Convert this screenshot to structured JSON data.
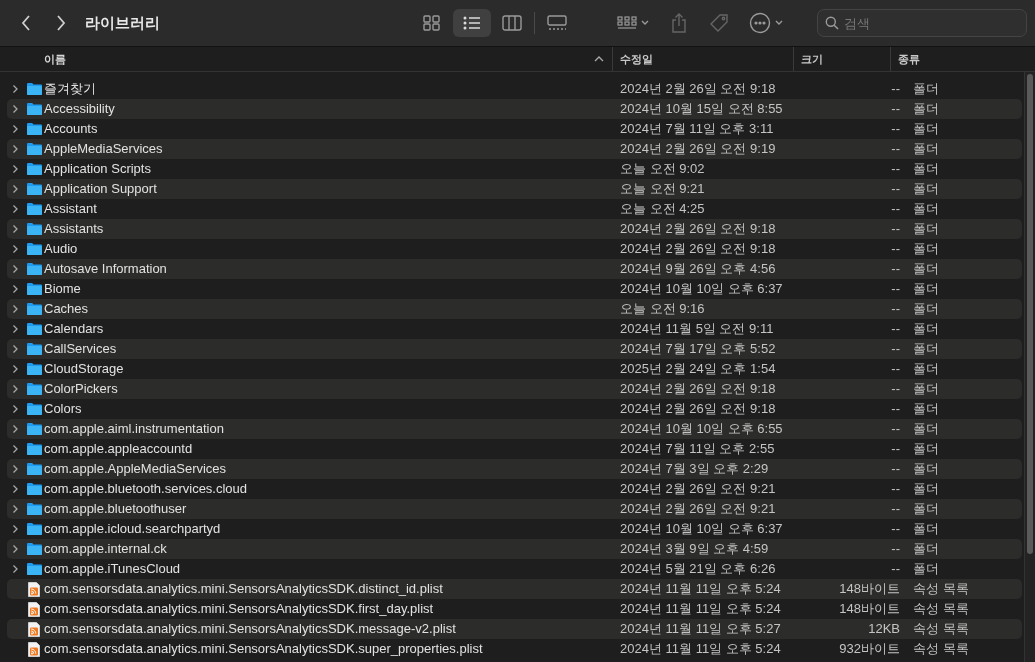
{
  "toolbar": {
    "title": "라이브러리",
    "views": [
      {
        "kind": "icons",
        "selected": false
      },
      {
        "kind": "list",
        "selected": true
      },
      {
        "kind": "columns",
        "selected": false
      },
      {
        "kind": "gallery",
        "selected": false
      }
    ],
    "search": {
      "placeholder": "검색"
    }
  },
  "columns": [
    {
      "label": "이름",
      "sorted": true
    },
    {
      "label": "수정일",
      "sorted": false
    },
    {
      "label": "크기",
      "sorted": false
    },
    {
      "label": "종류",
      "sorted": false
    }
  ],
  "rows": [
    {
      "kind": "folder",
      "name": "즐겨찾기",
      "date": "2024년 2월 26일 오전 9:18",
      "size": "--",
      "type": "폴더"
    },
    {
      "kind": "folder",
      "name": "Accessibility",
      "date": "2024년 10월 15일 오전 8:55",
      "size": "--",
      "type": "폴더"
    },
    {
      "kind": "folder",
      "name": "Accounts",
      "date": "2024년 7월 11일 오후 3:11",
      "size": "--",
      "type": "폴더"
    },
    {
      "kind": "folder",
      "name": "AppleMediaServices",
      "date": "2024년 2월 26일 오전 9:19",
      "size": "--",
      "type": "폴더"
    },
    {
      "kind": "folder",
      "name": "Application Scripts",
      "date": "오늘 오전 9:02",
      "size": "--",
      "type": "폴더"
    },
    {
      "kind": "folder",
      "name": "Application Support",
      "date": "오늘 오전 9:21",
      "size": "--",
      "type": "폴더"
    },
    {
      "kind": "folder",
      "name": "Assistant",
      "date": "오늘 오전 4:25",
      "size": "--",
      "type": "폴더"
    },
    {
      "kind": "folder",
      "name": "Assistants",
      "date": "2024년 2월 26일 오전 9:18",
      "size": "--",
      "type": "폴더"
    },
    {
      "kind": "folder",
      "name": "Audio",
      "date": "2024년 2월 26일 오전 9:18",
      "size": "--",
      "type": "폴더"
    },
    {
      "kind": "folder",
      "name": "Autosave Information",
      "date": "2024년 9월 26일 오후 4:56",
      "size": "--",
      "type": "폴더"
    },
    {
      "kind": "folder",
      "name": "Biome",
      "date": "2024년 10월 10일 오후 6:37",
      "size": "--",
      "type": "폴더"
    },
    {
      "kind": "folder",
      "name": "Caches",
      "date": "오늘 오전 9:16",
      "size": "--",
      "type": "폴더"
    },
    {
      "kind": "folder",
      "name": "Calendars",
      "date": "2024년 11월 5일 오전 9:11",
      "size": "--",
      "type": "폴더"
    },
    {
      "kind": "folder",
      "name": "CallServices",
      "date": "2024년 7월 17일 오후 5:52",
      "size": "--",
      "type": "폴더"
    },
    {
      "kind": "folder",
      "name": "CloudStorage",
      "date": "2025년 2월 24일 오후 1:54",
      "size": "--",
      "type": "폴더"
    },
    {
      "kind": "folder",
      "name": "ColorPickers",
      "date": "2024년 2월 26일 오전 9:18",
      "size": "--",
      "type": "폴더"
    },
    {
      "kind": "folder",
      "name": "Colors",
      "date": "2024년 2월 26일 오전 9:18",
      "size": "--",
      "type": "폴더"
    },
    {
      "kind": "folder",
      "name": "com.apple.aiml.instrumentation",
      "date": "2024년 10월 10일 오후 6:55",
      "size": "--",
      "type": "폴더"
    },
    {
      "kind": "folder",
      "name": "com.apple.appleaccountd",
      "date": "2024년 7월 11일 오후 2:55",
      "size": "--",
      "type": "폴더"
    },
    {
      "kind": "folder",
      "name": "com.apple.AppleMediaServices",
      "date": "2024년 7월 3일 오후 2:29",
      "size": "--",
      "type": "폴더"
    },
    {
      "kind": "folder",
      "name": "com.apple.bluetooth.services.cloud",
      "date": "2024년 2월 26일 오전 9:21",
      "size": "--",
      "type": "폴더"
    },
    {
      "kind": "folder",
      "name": "com.apple.bluetoothuser",
      "date": "2024년 2월 26일 오전 9:21",
      "size": "--",
      "type": "폴더"
    },
    {
      "kind": "folder",
      "name": "com.apple.icloud.searchpartyd",
      "date": "2024년 10월 10일 오후 6:37",
      "size": "--",
      "type": "폴더"
    },
    {
      "kind": "folder",
      "name": "com.apple.internal.ck",
      "date": "2024년 3월 9일 오후 4:59",
      "size": "--",
      "type": "폴더"
    },
    {
      "kind": "folder",
      "name": "com.apple.iTunesCloud",
      "date": "2024년 5월 21일 오후 6:26",
      "size": "--",
      "type": "폴더"
    },
    {
      "kind": "file",
      "name": "com.sensorsdata.analytics.mini.SensorsAnalyticsSDK.distinct_id.plist",
      "date": "2024년 11월 11일 오후 5:24",
      "size": "148바이트",
      "type": "속성 목록"
    },
    {
      "kind": "file",
      "name": "com.sensorsdata.analytics.mini.SensorsAnalyticsSDK.first_day.plist",
      "date": "2024년 11월 11일 오후 5:24",
      "size": "148바이트",
      "type": "속성 목록"
    },
    {
      "kind": "file",
      "name": "com.sensorsdata.analytics.mini.SensorsAnalyticsSDK.message-v2.plist",
      "date": "2024년 11월 11일 오후 5:27",
      "size": "12KB",
      "type": "속성 목록"
    },
    {
      "kind": "file",
      "name": "com.sensorsdata.analytics.mini.SensorsAnalyticsSDK.super_properties.plist",
      "date": "2024년 11월 11일 오후 5:24",
      "size": "932바이트",
      "type": "속성 목록"
    }
  ]
}
